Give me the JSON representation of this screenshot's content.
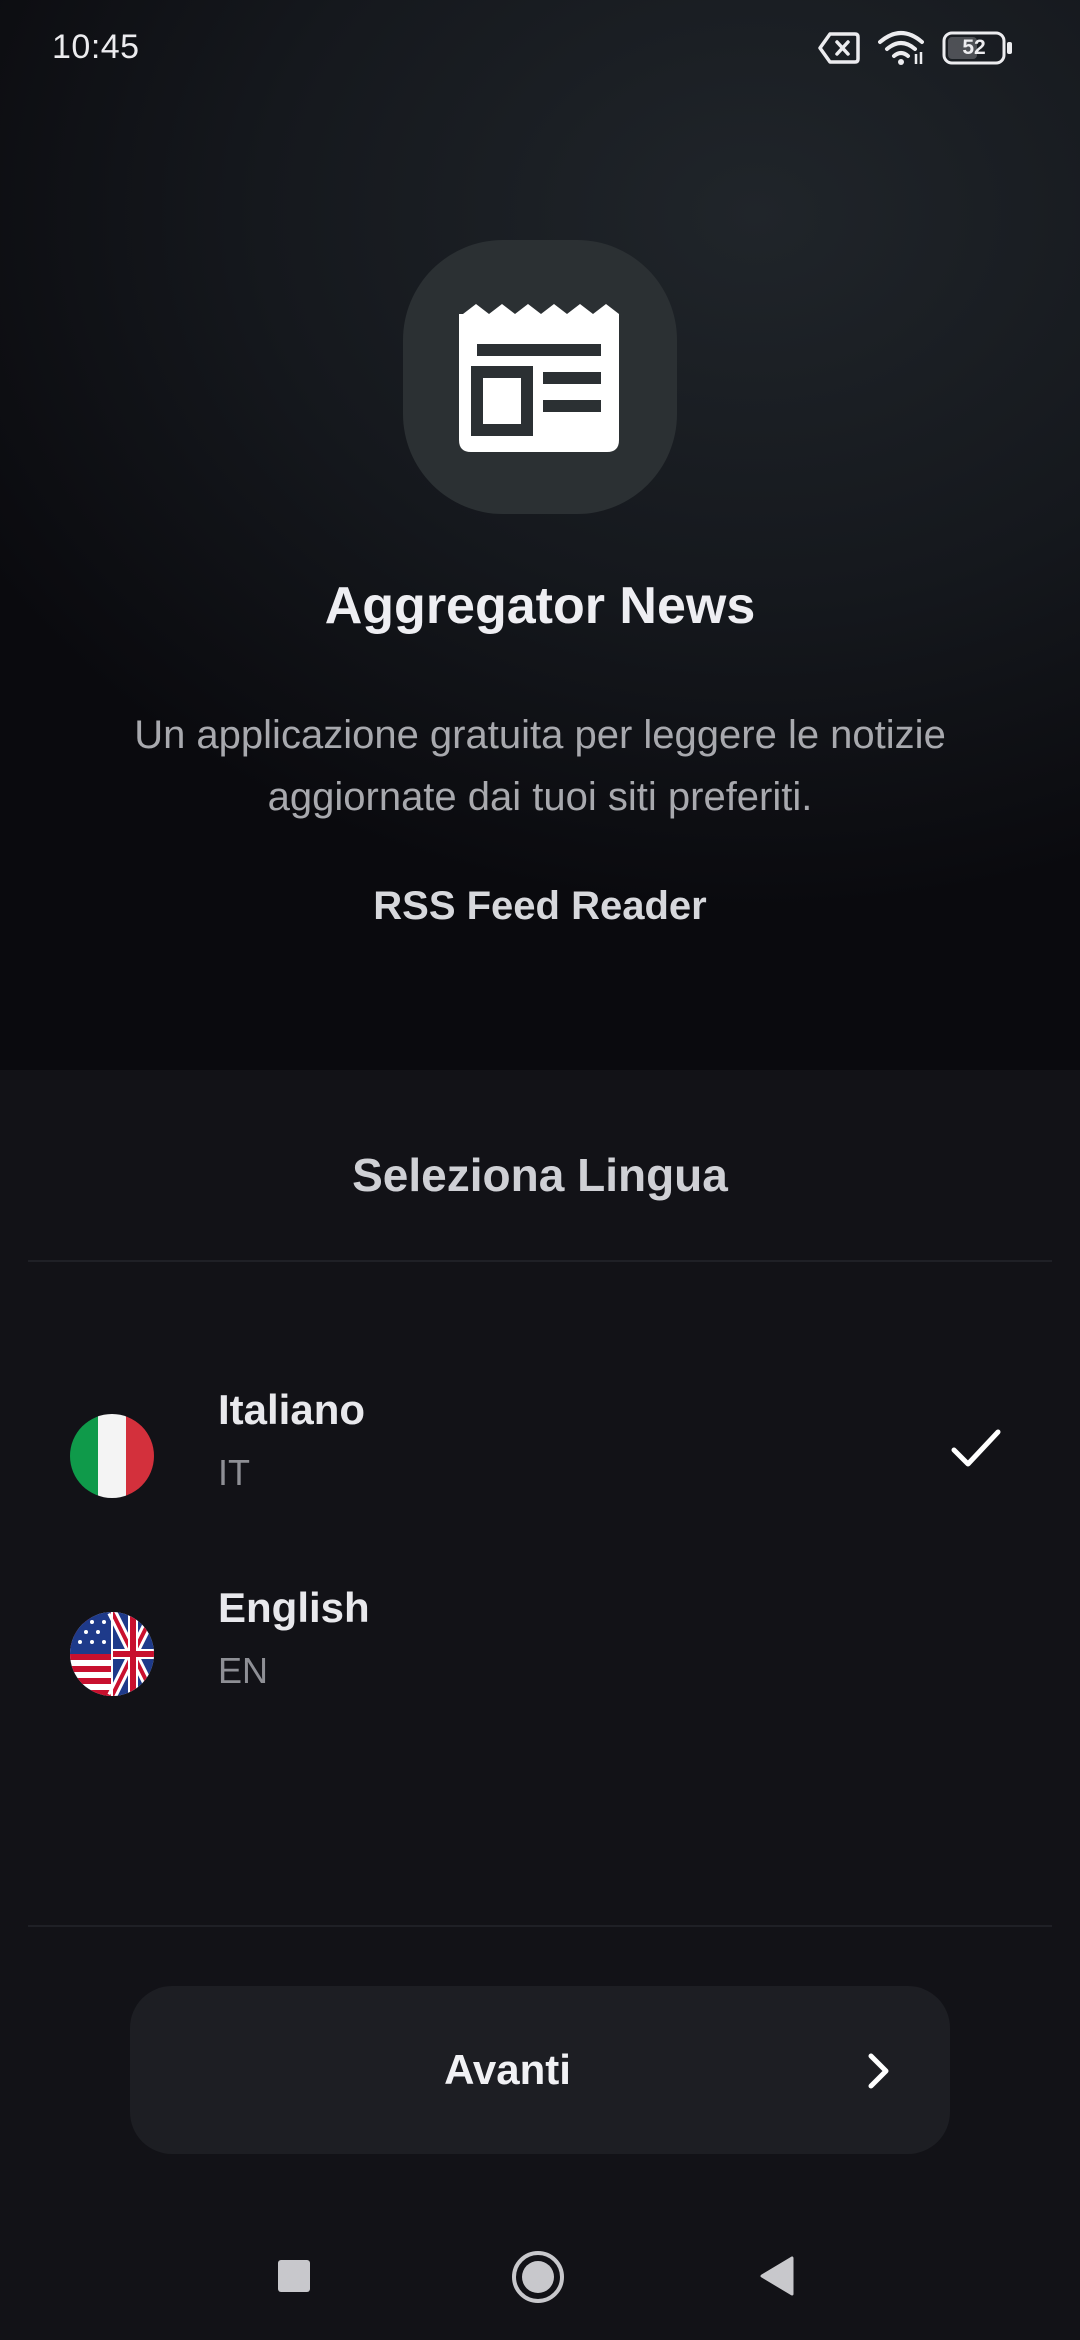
{
  "status_bar": {
    "time": "10:45",
    "battery_level": "52",
    "icons": [
      "notification-off-icon",
      "wifi-icon",
      "battery-icon"
    ]
  },
  "hero": {
    "app_icon": "newspaper-icon",
    "app_title": "Aggregator News",
    "description": "Un applicazione gratuita per leggere le notizie aggiornate dai tuoi siti preferiti.",
    "tagline": "RSS Feed Reader"
  },
  "language": {
    "heading": "Seleziona Lingua",
    "options": [
      {
        "name": "Italiano",
        "code": "IT",
        "flag": "italy-flag-icon",
        "selected": true
      },
      {
        "name": "English",
        "code": "EN",
        "flag": "us-uk-flag-icon",
        "selected": false
      }
    ]
  },
  "next_button": {
    "label": "Avanti",
    "icon": "chevron-right-icon"
  },
  "nav_bar": {
    "buttons": [
      "recent-apps-icon",
      "home-icon",
      "back-icon"
    ]
  },
  "colors": {
    "background": "#121217",
    "hero_background": "#15181d",
    "icon_tile": "#2b3033",
    "button_background": "#1d1e23",
    "text_primary": "#e8e8ec",
    "text_secondary": "#8e8f95"
  }
}
